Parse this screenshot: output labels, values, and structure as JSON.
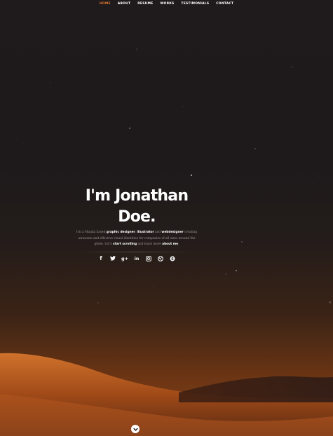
{
  "nav": {
    "items": [
      {
        "label": "Home",
        "active": true
      },
      {
        "label": "About",
        "active": false
      },
      {
        "label": "Resume",
        "active": false
      },
      {
        "label": "Works",
        "active": false
      },
      {
        "label": "Testimonials",
        "active": false
      },
      {
        "label": "Contact",
        "active": false
      }
    ],
    "active_color": "#e0742c"
  },
  "hero": {
    "title": "I'm Jonathan Doe.",
    "intro": {
      "t1": "I'm a Manila based ",
      "b1": "graphic designer",
      "t2": ", ",
      "b2": "illustrator",
      "t3": " and ",
      "b3": "webdesigner",
      "t4": " creating awesome and effective visual identities for companies of all sizes around the globe. Let's ",
      "b4": "start scrolling",
      "t5": " and learn more ",
      "b5": "about me",
      "t6": "."
    }
  },
  "social": [
    {
      "icon": "facebook-icon",
      "glyph": "f"
    },
    {
      "icon": "twitter-icon",
      "glyph": "🐦"
    },
    {
      "icon": "google-plus-icon",
      "glyph": "g+"
    },
    {
      "icon": "linkedin-icon",
      "glyph": "in"
    },
    {
      "icon": "instagram-icon",
      "glyph": "◎"
    },
    {
      "icon": "dribbble-icon",
      "glyph": "⊛"
    },
    {
      "icon": "skype-icon",
      "glyph": "S"
    }
  ],
  "scroll_down_icon": "chevron-down-icon",
  "colors": {
    "background": "#1d1a1b",
    "dune": "#b85a20"
  }
}
